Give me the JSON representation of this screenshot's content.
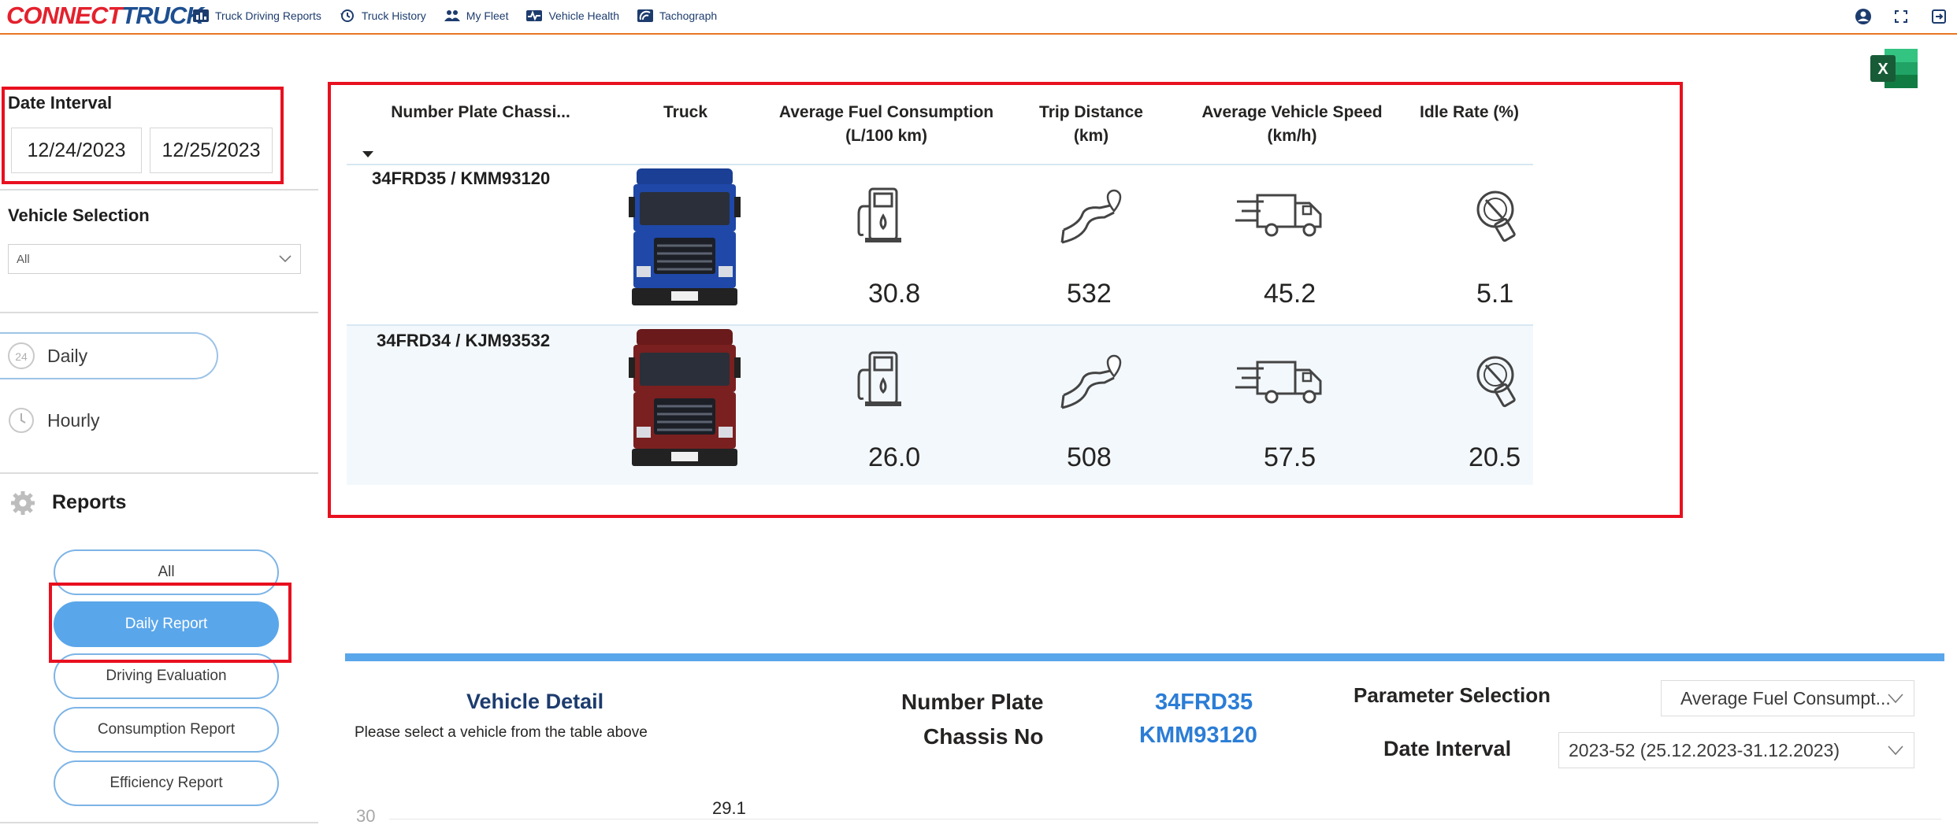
{
  "app": {
    "logo_part1": "CONNECT",
    "logo_part2": "RUCK"
  },
  "nav": {
    "items": [
      {
        "label": "Truck Driving Reports",
        "icon": "bar-chart-icon"
      },
      {
        "label": "Truck History",
        "icon": "history-icon"
      },
      {
        "label": "My Fleet",
        "icon": "fleet-people-icon"
      },
      {
        "label": "Vehicle Health",
        "icon": "vehicle-health-icon"
      },
      {
        "label": "Tachograph",
        "icon": "tachograph-icon"
      }
    ],
    "right_icons": [
      "account-icon",
      "fullscreen-icon",
      "logout-icon"
    ]
  },
  "filters": {
    "date_interval_label": "Date Interval",
    "date_start": "12/24/2023",
    "date_end": "12/25/2023",
    "vehicle_selection_label": "Vehicle Selection",
    "vehicle_selection_value": "All",
    "period_options": [
      {
        "label": "Daily",
        "selected": true,
        "icon": "24h-icon"
      },
      {
        "label": "Hourly",
        "selected": false,
        "icon": "clock-icon"
      }
    ]
  },
  "reports": {
    "title": "Reports",
    "items": [
      {
        "label": "All",
        "active": false
      },
      {
        "label": "Daily Report",
        "active": true
      },
      {
        "label": "Driving Evaluation",
        "active": false
      },
      {
        "label": "Consumption Report",
        "active": false
      },
      {
        "label": "Efficiency Report",
        "active": false
      }
    ]
  },
  "table": {
    "columns": [
      "Number Plate Chassi...",
      "Truck",
      "Average Fuel Consumption (L/100 km)",
      "Trip Distance (km)",
      "Average Vehicle Speed (km/h)",
      "Idle Rate (%)"
    ],
    "rows": [
      {
        "plate": "34FRD35 / KMM93120",
        "truck_color": "#1f48a8",
        "fuel": "30.8",
        "distance": "532",
        "speed": "45.2",
        "idle": "5.1"
      },
      {
        "plate": "34FRD34 / KJM93532",
        "truck_color": "#7a2020",
        "fuel": "26.0",
        "distance": "508",
        "speed": "57.5",
        "idle": "20.5"
      }
    ]
  },
  "vehicle_detail": {
    "title": "Vehicle Detail",
    "hint": "Please select a vehicle from the table above",
    "number_plate_label": "Number Plate",
    "number_plate_value": "34FRD35",
    "chassis_label": "Chassis No",
    "chassis_value": "KMM93120",
    "parameter_label": "Parameter Selection",
    "parameter_value": "Average Fuel Consumpt...",
    "date_interval_label": "Date Interval",
    "date_interval_value": "2023-52 (25.12.2023-31.12.2023)",
    "chart_axis_tick": "30",
    "chart_data_label": "29.1"
  },
  "colors": {
    "accent": "#5aa6ea",
    "highlight_box": "#e8101f",
    "brand_blue": "#1d4f91",
    "brand_red": "#e4212d"
  }
}
